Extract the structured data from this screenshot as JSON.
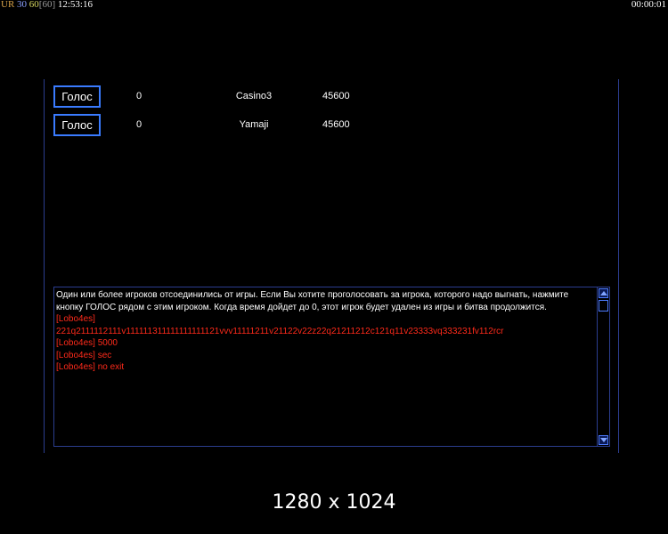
{
  "overlay": {
    "ur_label": "UR",
    "fps_a": "30",
    "fps_b": "60",
    "fps_bracket": "[60]",
    "clock": "12:53:16",
    "timer": "00:00:01"
  },
  "players": [
    {
      "button_label": "Голос",
      "votes": "0",
      "name": "Casino3",
      "score": "45600"
    },
    {
      "button_label": "Голос",
      "votes": "0",
      "name": "Yamaji",
      "score": "45600"
    }
  ],
  "chat": {
    "system_message": "Один или более игроков отсоединились от игры. Если Вы хотите проголосовать за игрока, которого надо выгнать, нажмите кнопку ГОЛОС рядом с этим игроком. Когда время дойдет до 0, этот игрок будет удален из игры и битва продолжится.",
    "messages": [
      "[Lobo4es]",
      " 221q2111112111v111111311111111111121vvv11111211v21122v22z22q21211212c121q11v23333vq333231fv112rcr",
      "[Lobo4es] 5000",
      "[Lobo4es] sec",
      "[Lobo4es] no exit"
    ]
  },
  "footer": {
    "resolution": "1280 x 1024"
  },
  "colors": {
    "background": "#000000",
    "panel_border": "#2b3d8f",
    "button_border": "#3a7bff",
    "chat_red": "#ff2a1a"
  }
}
